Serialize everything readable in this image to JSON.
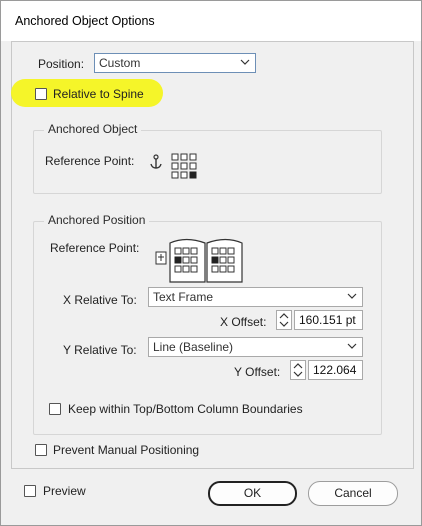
{
  "window": {
    "title": "Anchored Object Options"
  },
  "position": {
    "label": "Position:",
    "value": "Custom"
  },
  "relative_to_spine": {
    "label": "Relative to Spine",
    "checked": false
  },
  "anchored_object": {
    "group_label": "Anchored Object",
    "reference_point_label": "Reference Point:",
    "anchor_icon": "anchor-icon",
    "selected_point": "bottom-right"
  },
  "anchored_position": {
    "group_label": "Anchored Position",
    "reference_point_label": "Reference Point:",
    "x_relative_label": "X Relative To:",
    "x_relative_value": "Text Frame",
    "x_offset_label": "X Offset:",
    "x_offset_value": "160.151 pt",
    "y_relative_label": "Y Relative To:",
    "y_relative_value": "Line (Baseline)",
    "y_offset_label": "Y Offset:",
    "y_offset_value": "122.064",
    "keep_within_label": "Keep within Top/Bottom Column Boundaries",
    "keep_within_checked": false
  },
  "prevent_manual": {
    "label": "Prevent Manual Positioning",
    "checked": false
  },
  "preview": {
    "label": "Preview",
    "checked": false
  },
  "buttons": {
    "ok": "OK",
    "cancel": "Cancel"
  },
  "colors": {
    "highlight": "#f4f41d",
    "dialog_bg": "#f0f0f0"
  }
}
